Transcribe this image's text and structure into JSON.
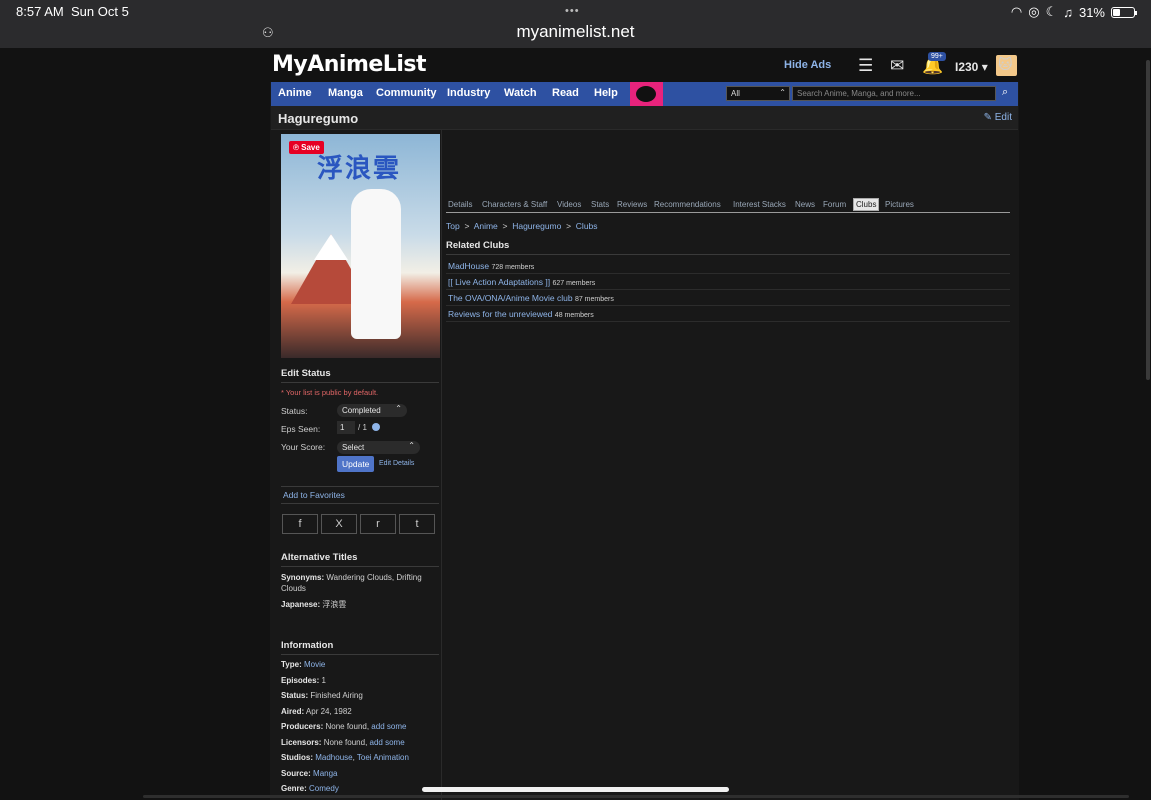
{
  "status_bar": {
    "time": "8:57 AM",
    "date": "Sun Oct 5",
    "dots": "•••",
    "battery": "31%"
  },
  "browser": {
    "url": "myanimelist.net"
  },
  "header": {
    "logo": "MyAnimeList",
    "hide_ads": "Hide Ads",
    "notif_badge": "99+",
    "username": "I230"
  },
  "nav": {
    "items": [
      "Anime",
      "Manga",
      "Community",
      "Industry",
      "Watch",
      "Read",
      "Help"
    ],
    "search_category": "All",
    "search_placeholder": "Search Anime, Manga, and more..."
  },
  "page": {
    "title": "Haguregumo",
    "edit_label": "Edit"
  },
  "poster": {
    "save_label": "Save",
    "kanji": "浮浪雲"
  },
  "edit_status": {
    "heading": "Edit Status",
    "note": "* Your list is public by default.",
    "status_label": "Status:",
    "status_value": "Completed",
    "eps_label": "Eps Seen:",
    "eps_value": "1",
    "eps_total": "/ 1",
    "score_label": "Your Score:",
    "score_value": "Select",
    "update_label": "Update",
    "edit_details": "Edit Details"
  },
  "favorites": {
    "label": "Add to Favorites"
  },
  "share_icons": [
    "f",
    "X",
    "r",
    "t"
  ],
  "alt_titles": {
    "heading": "Alternative Titles",
    "synonyms_label": "Synonyms:",
    "synonyms_value": "Wandering Clouds, Drifting Clouds",
    "japanese_label": "Japanese:",
    "japanese_value": "浮浪雲"
  },
  "information": {
    "heading": "Information",
    "type_label": "Type:",
    "type_value": "Movie",
    "episodes_label": "Episodes:",
    "episodes_value": "1",
    "status_label": "Status:",
    "status_value": "Finished Airing",
    "aired_label": "Aired:",
    "aired_value": "Apr 24, 1982",
    "producers_label": "Producers:",
    "producers_value": "None found,",
    "producers_link": "add some",
    "licensors_label": "Licensors:",
    "licensors_value": "None found,",
    "licensors_link": "add some",
    "studios_label": "Studios:",
    "studios_value_1": "Madhouse",
    "studios_value_2": "Toei Animation",
    "source_label": "Source:",
    "source_value": "Manga",
    "genre_label": "Genre:",
    "genre_value": "Comedy"
  },
  "tabs": [
    "Details",
    "Characters & Staff",
    "Videos",
    "Stats",
    "Reviews",
    "Recommendations",
    "Interest Stacks",
    "News",
    "Forum",
    "Clubs",
    "Pictures"
  ],
  "active_tab": "Clubs",
  "breadcrumb": [
    "Top",
    "Anime",
    "Haguregumo",
    "Clubs"
  ],
  "related_clubs": {
    "heading": "Related Clubs",
    "clubs": [
      {
        "name": "MadHouse",
        "members": "728 members"
      },
      {
        "name": "[[ Live Action Adaptations ]]",
        "members": "627 members"
      },
      {
        "name": "The OVA/ONA/Anime Movie club",
        "members": "87 members"
      },
      {
        "name": "Reviews for the unreviewed",
        "members": "48 members"
      }
    ]
  },
  "colors": {
    "nav_blue": "#2e51a2",
    "link": "#8eb4e8",
    "background": "#121212"
  }
}
